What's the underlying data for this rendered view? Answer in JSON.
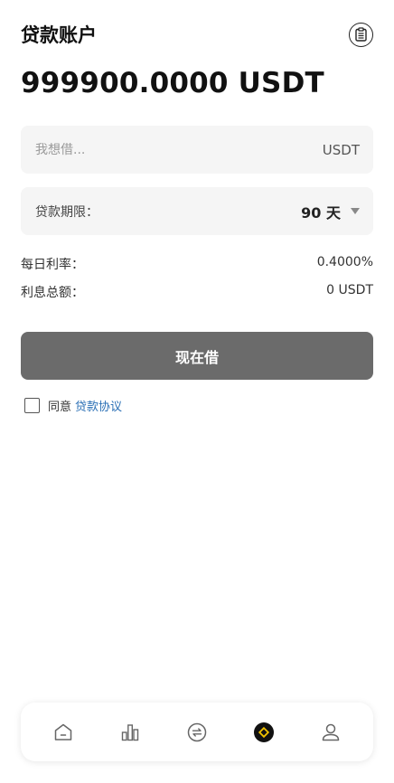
{
  "header": {
    "title": "贷款账户",
    "records_icon": "clipboard-icon"
  },
  "balance": {
    "text": "999900.0000 USDT"
  },
  "amount": {
    "placeholder": "我想借...",
    "value": "",
    "unit": "USDT"
  },
  "term": {
    "label": "贷款期限：",
    "value": "90 天",
    "options_visible": [
      "90 天"
    ]
  },
  "info": {
    "daily_rate_label": "每日利率：",
    "daily_rate_value": "0.4000%",
    "total_interest_label": "利息总额：",
    "total_interest_value": "0 USDT"
  },
  "action": {
    "borrow_label": "现在借"
  },
  "agreement": {
    "prefix": "同意",
    "link": "贷款协议",
    "checked": false
  },
  "tabbar": {
    "items": [
      {
        "icon": "home-icon",
        "active": false
      },
      {
        "icon": "bar-chart-icon",
        "active": false
      },
      {
        "icon": "exchange-icon",
        "active": false
      },
      {
        "icon": "loan-diamond-icon",
        "active": true
      },
      {
        "icon": "user-icon",
        "active": false
      }
    ]
  },
  "colors": {
    "button_bg": "#6b6b6b",
    "link": "#2a6fb5",
    "field_bg": "#f5f5f5",
    "active_tab": "#111111",
    "active_tab_accent": "#f2c200"
  }
}
